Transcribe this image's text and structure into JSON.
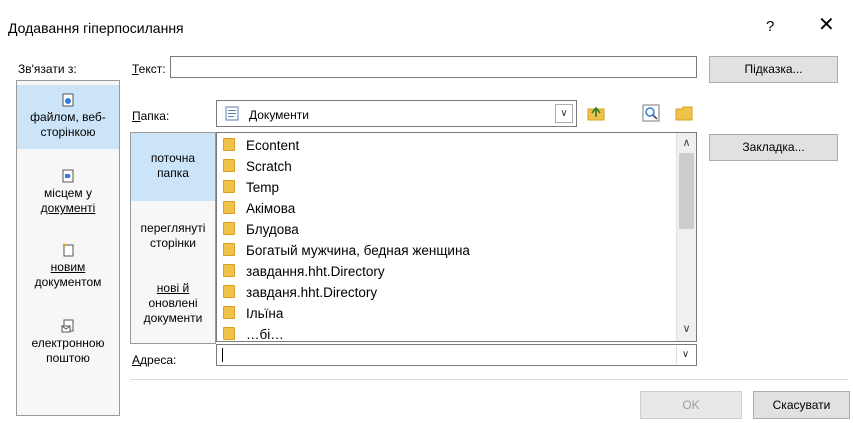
{
  "dialog": {
    "title": "Додавання гіперпосилання",
    "help_label": "?",
    "close_label": "✕"
  },
  "link_to": {
    "label": "Зв'язати з:",
    "items": [
      {
        "line1": "файлом, веб-",
        "line2": "сторінкою",
        "icon": "file-web-icon",
        "selected": true
      },
      {
        "line1": "місцем у",
        "line2": "документі",
        "icon": "bookmark-place-icon",
        "selected": false
      },
      {
        "line1": "новим",
        "line2": "документом",
        "icon": "new-document-icon",
        "selected": false
      },
      {
        "line1": "електронною",
        "line2": "поштою",
        "icon": "email-icon",
        "selected": false
      }
    ]
  },
  "text": {
    "label": "Текст:",
    "value": ""
  },
  "buttons": {
    "tooltip": "Підказка...",
    "bookmark": "Закладка...",
    "ok": "OK",
    "cancel": "Скасувати"
  },
  "folder": {
    "label": "Папка:",
    "value": "Документи",
    "icon": "documents-folder-icon"
  },
  "tools": [
    "folder-up-icon",
    "browse-web-icon",
    "browse-file-icon"
  ],
  "nav": [
    {
      "line1": "поточна",
      "line2": "папка",
      "selected": true
    },
    {
      "line1": "переглянуті",
      "line2": "сторінки",
      "selected": false
    },
    {
      "line1": "нові й",
      "line2": "оновлені",
      "line3": "документи",
      "selected": false
    }
  ],
  "files": [
    "Econtent",
    "Scratch",
    "Temp",
    "Акімова",
    "Блудова",
    "Богатый мужчина, бедная женщина",
    "завдання.hht.Directory",
    "завданя.hht.Directory",
    "Ільїна",
    "…бі…"
  ],
  "address": {
    "label": "Адреса:",
    "value": ""
  },
  "colors": {
    "selected_bg": "#cce4f7",
    "folder_yellow": "#f0c24c"
  }
}
